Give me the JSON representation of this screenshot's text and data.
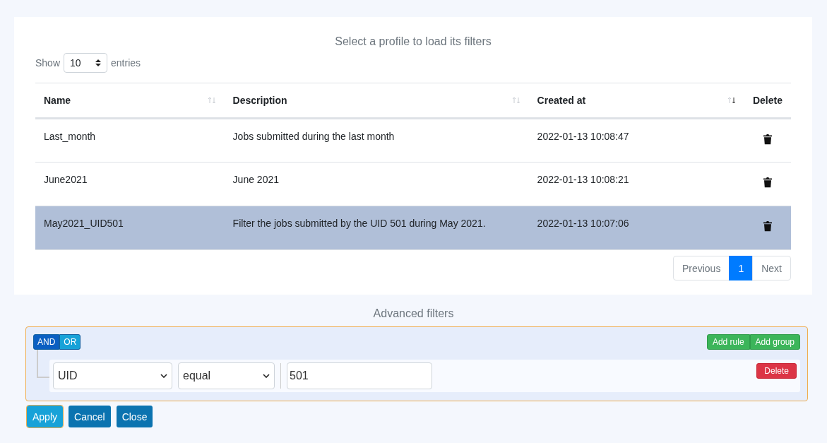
{
  "profiles": {
    "title": "Select a profile to load its filters",
    "length": {
      "label_before": "Show",
      "value": "10",
      "label_after": "entries"
    },
    "columns": [
      {
        "label": "Name",
        "sorted_desc": false
      },
      {
        "label": "Description",
        "sorted_desc": false
      },
      {
        "label": "Created at",
        "sorted_desc": true
      },
      {
        "label": "Delete"
      }
    ],
    "rows": [
      {
        "name": "Last_month",
        "description": "Jobs submitted during the last month",
        "created_at": "2022-01-13 10:08:47",
        "selected": false
      },
      {
        "name": "June2021",
        "description": "June 2021",
        "created_at": "2022-01-13 10:08:21",
        "selected": false
      },
      {
        "name": "May2021_UID501",
        "description": "Filter the jobs submitted by the UID 501 during May 2021.",
        "created_at": "2022-01-13 10:07:06",
        "selected": true
      }
    ],
    "pagination": [
      {
        "label": "Previous",
        "selected": false
      },
      {
        "label": "1",
        "selected": true
      },
      {
        "label": "Next",
        "selected": false
      }
    ]
  },
  "advanced_filters": {
    "title": "Advanced filters",
    "conditions": [
      {
        "label": "AND",
        "selected": true
      },
      {
        "label": "OR",
        "selected": false
      }
    ],
    "group_buttons": [
      "Add rule",
      "Add group"
    ],
    "rule": {
      "field": "UID",
      "operator": "equal",
      "value": "501",
      "delete": "Delete"
    }
  },
  "actions": [
    "Apply",
    "Cancel",
    "Close"
  ]
}
